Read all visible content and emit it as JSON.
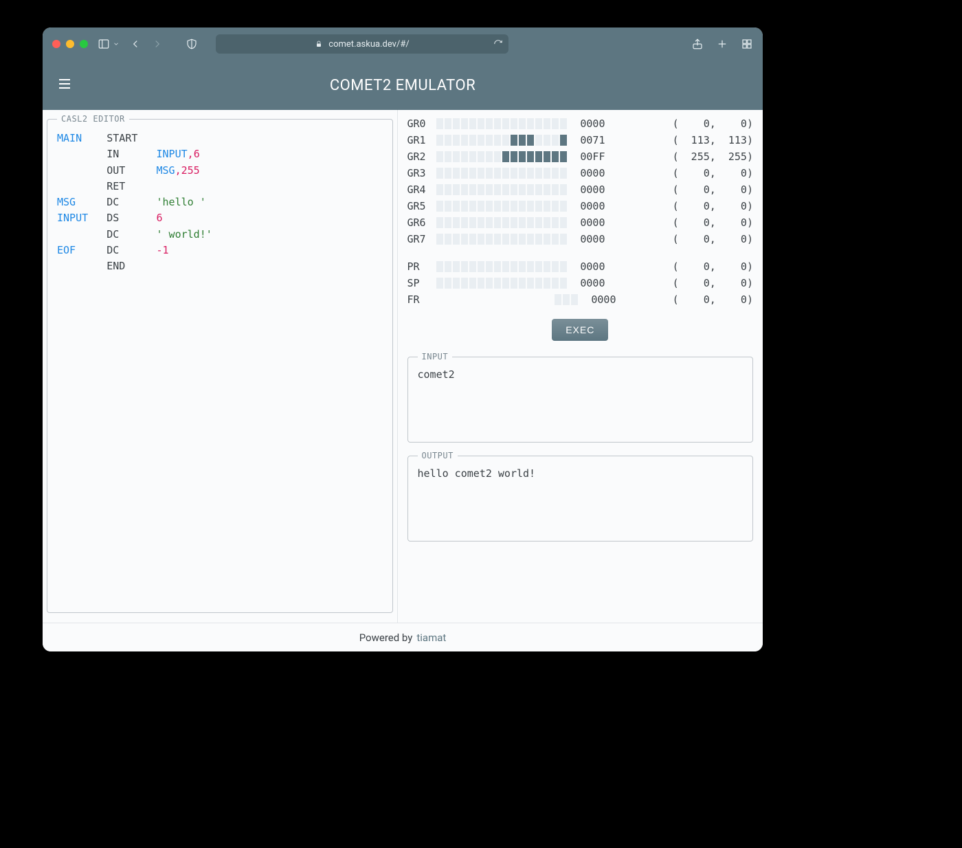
{
  "browser": {
    "url": "comet.askua.dev/#/"
  },
  "app": {
    "title": "COMET2 EMULATOR"
  },
  "editor": {
    "legend": "CASL2 EDITOR",
    "lines": [
      {
        "label": "MAIN",
        "op": "START",
        "args": []
      },
      {
        "label": "",
        "op": "IN",
        "args": [
          {
            "t": "arg",
            "v": "INPUT"
          },
          {
            "t": "comma",
            "v": ","
          },
          {
            "t": "num",
            "v": "6"
          }
        ]
      },
      {
        "label": "",
        "op": "OUT",
        "args": [
          {
            "t": "arg",
            "v": "MSG"
          },
          {
            "t": "comma",
            "v": ","
          },
          {
            "t": "num",
            "v": "255"
          }
        ]
      },
      {
        "label": "",
        "op": "RET",
        "args": []
      },
      {
        "label": "MSG",
        "op": "DC",
        "args": [
          {
            "t": "str",
            "v": "'hello '"
          }
        ]
      },
      {
        "label": "INPUT",
        "op": "DS",
        "args": [
          {
            "t": "num",
            "v": "6"
          }
        ]
      },
      {
        "label": "",
        "op": "DC",
        "args": [
          {
            "t": "str",
            "v": "' world!'"
          }
        ]
      },
      {
        "label": "EOF",
        "op": "DC",
        "args": [
          {
            "t": "num",
            "v": "-1"
          }
        ]
      },
      {
        "label": "",
        "op": "END",
        "args": []
      }
    ]
  },
  "registers": {
    "gr": [
      {
        "name": "GR0",
        "hex": "0000",
        "dec": 0,
        "signed": 0,
        "bits": "0000000000000000"
      },
      {
        "name": "GR1",
        "hex": "0071",
        "dec": 113,
        "signed": 113,
        "bits": "0000000001110001"
      },
      {
        "name": "GR2",
        "hex": "00FF",
        "dec": 255,
        "signed": 255,
        "bits": "0000000011111111"
      },
      {
        "name": "GR3",
        "hex": "0000",
        "dec": 0,
        "signed": 0,
        "bits": "0000000000000000"
      },
      {
        "name": "GR4",
        "hex": "0000",
        "dec": 0,
        "signed": 0,
        "bits": "0000000000000000"
      },
      {
        "name": "GR5",
        "hex": "0000",
        "dec": 0,
        "signed": 0,
        "bits": "0000000000000000"
      },
      {
        "name": "GR6",
        "hex": "0000",
        "dec": 0,
        "signed": 0,
        "bits": "0000000000000000"
      },
      {
        "name": "GR7",
        "hex": "0000",
        "dec": 0,
        "signed": 0,
        "bits": "0000000000000000"
      }
    ],
    "special": [
      {
        "name": "PR",
        "hex": "0000",
        "dec": 0,
        "signed": 0,
        "bits": "0000000000000000"
      },
      {
        "name": "SP",
        "hex": "0000",
        "dec": 0,
        "signed": 0,
        "bits": "0000000000000000"
      }
    ],
    "fr": {
      "name": "FR",
      "hex": "0000",
      "dec": 0,
      "signed": 0,
      "bits": "000"
    }
  },
  "exec_label": "EXEC",
  "input": {
    "legend": "INPUT",
    "value": "comet2"
  },
  "output": {
    "legend": "OUTPUT",
    "value": "hello comet2 world!"
  },
  "footer": {
    "text": "Powered by",
    "link": "tiamat"
  }
}
